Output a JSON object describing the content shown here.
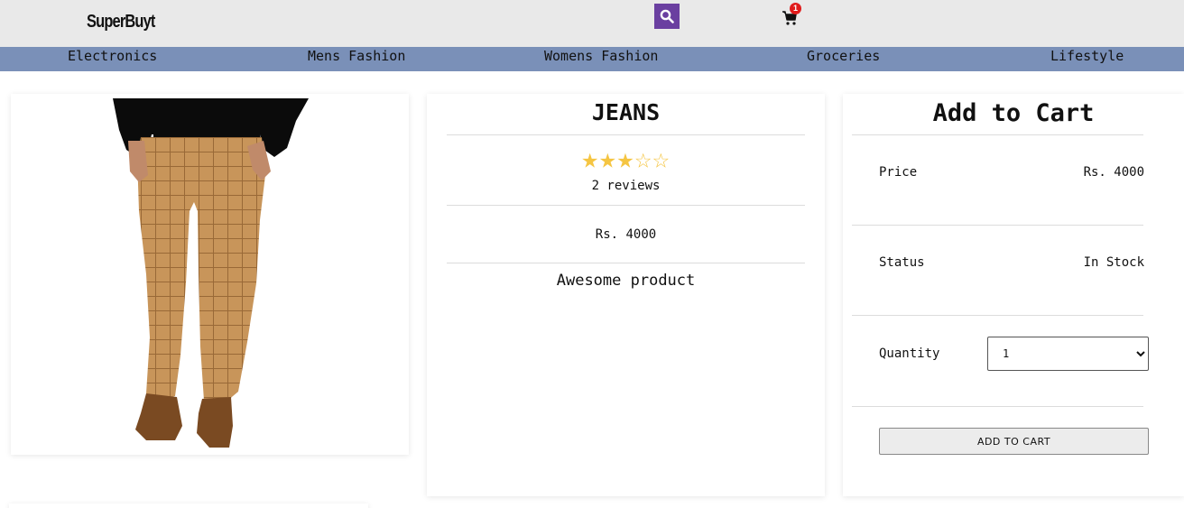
{
  "header": {
    "logo": "SuperBuyt",
    "cart_count": "1"
  },
  "nav": {
    "items": [
      "Electronics",
      "Mens Fashion",
      "Womens Fashion",
      "Groceries",
      "Lifestyle"
    ]
  },
  "product": {
    "title": "JEANS",
    "rating": 3,
    "rating_max": 5,
    "reviews": "2 reviews",
    "price": "Rs. 4000",
    "description": "Awesome product",
    "image_alt": "khaki checked trousers"
  },
  "cart": {
    "title": "Add to Cart",
    "price_label": "Price",
    "price_value": "Rs. 4000",
    "status_label": "Status",
    "status_value": "In Stock",
    "quantity_label": "Quantity",
    "quantity_selected": "1",
    "button_label": "ADD TO CART"
  },
  "colors": {
    "header_bg": "#e9e9e9",
    "nav_bg": "#7a90b8",
    "search_bg": "#6a3fa0",
    "star": "#f5c542",
    "badge": "#e01b1b"
  },
  "icons": {
    "search": "search-icon",
    "cart": "cart-icon"
  }
}
